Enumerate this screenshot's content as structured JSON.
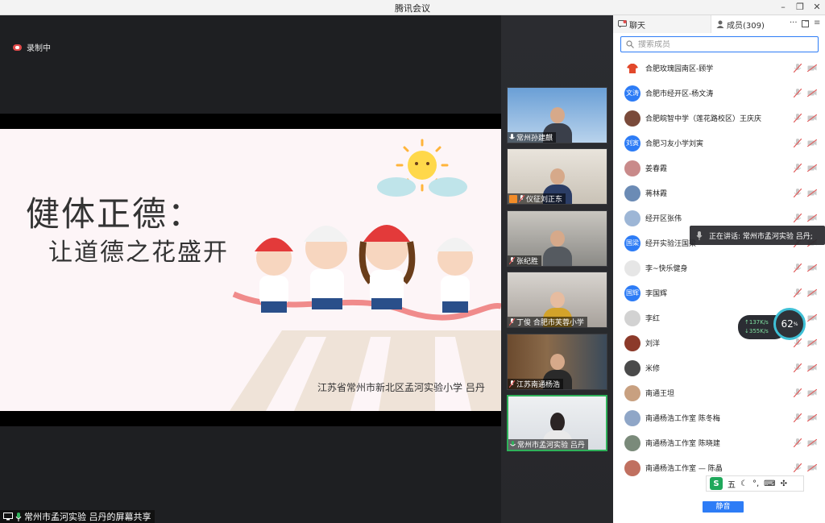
{
  "window": {
    "title": "腾讯会议"
  },
  "recording": {
    "label": "录制中"
  },
  "slide": {
    "title_line1": "健体正德：",
    "title_line2": "让道德之花盛开",
    "caption": "江苏省常州市新北区孟河实验小学 吕丹"
  },
  "share_bar": {
    "label": "常州市孟河实验 吕丹的屏幕共享"
  },
  "video_tiles": [
    {
      "name": "常州孙建麒",
      "mic": "on"
    },
    {
      "name": "仪征刘正东",
      "mic": "off"
    },
    {
      "name": "张纪胜",
      "mic": "off"
    },
    {
      "name": "丁俊 合肥市芙蓉小学",
      "mic": "off"
    },
    {
      "name": "江苏南通杨浩",
      "mic": "off"
    },
    {
      "name": "常州市孟河实验 吕丹",
      "mic": "on"
    }
  ],
  "panel": {
    "chat_tab": "聊天",
    "members_tab": "成员(309)",
    "more_label": "···",
    "search_placeholder": "搜索成员",
    "mute_all_label": "静音",
    "members": [
      {
        "name": "合肥玫瑰园南区-顾学",
        "avatar_text": "",
        "avatar_color": "#ffffff"
      },
      {
        "name": "合肥市经开区-杨文涛",
        "avatar_text": "文涛",
        "avatar_color": "#2d7cf6"
      },
      {
        "name": "合肥皖智中学（莲花路校区）王庆庆",
        "avatar_text": "",
        "avatar_color": "#7a4a3a"
      },
      {
        "name": "合肥习友小学刘寅",
        "avatar_text": "刘寅",
        "avatar_color": "#2d7cf6"
      },
      {
        "name": "姜春霞",
        "avatar_text": "",
        "avatar_color": "#c98a8a"
      },
      {
        "name": "蒋林霞",
        "avatar_text": "",
        "avatar_color": "#6b8bb5"
      },
      {
        "name": "经开区张伟",
        "avatar_text": "",
        "avatar_color": "#9db6d6"
      },
      {
        "name": "经开实验汪国梁",
        "avatar_text": "国梁",
        "avatar_color": "#2d7cf6"
      },
      {
        "name": "李~快乐健身",
        "avatar_text": "",
        "avatar_color": "#e6e6e6"
      },
      {
        "name": "李国辉",
        "avatar_text": "国辉",
        "avatar_color": "#2d7cf6"
      },
      {
        "name": "李红",
        "avatar_text": "",
        "avatar_color": "#d2d2d2"
      },
      {
        "name": "刘洋",
        "avatar_text": "",
        "avatar_color": "#8c3a2a"
      },
      {
        "name": "米修",
        "avatar_text": "",
        "avatar_color": "#4a4a4a"
      },
      {
        "name": "南通王坦",
        "avatar_text": "",
        "avatar_color": "#c8a080"
      },
      {
        "name": "南通杨浩工作室 陈冬梅",
        "avatar_text": "",
        "avatar_color": "#8fa6c7"
      },
      {
        "name": "南通杨浩工作室 陈晓建",
        "avatar_text": "",
        "avatar_color": "#7a8a7a"
      },
      {
        "name": "南通杨浩工作室 — 陈晶",
        "avatar_text": "",
        "avatar_color": "#c07060"
      }
    ]
  },
  "speaking_tooltip": {
    "label": "正在讲话: 常州市孟河实验 吕丹;"
  },
  "network": {
    "up": "↑137K/s",
    "down": "↓355K/s",
    "cpu_value": "62",
    "cpu_unit": "%"
  },
  "ime": {
    "logo": "S",
    "mode": "五",
    "icons": [
      "moon-icon",
      "punctuation-icon",
      "keyboard-icon",
      "grid-icon"
    ]
  },
  "colors": {
    "accent": "#2d7cf6",
    "active_speaker": "#2fb15a",
    "muted": "#e05a5a"
  }
}
